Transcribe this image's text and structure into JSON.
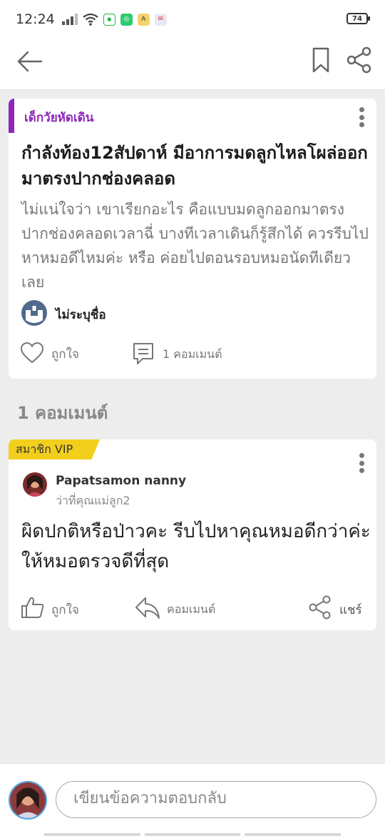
{
  "status_bar": {
    "time": "12:24",
    "battery": "74"
  },
  "post": {
    "category": "เด็กวัยหัดเดิน",
    "title": "กำลังท้อง12สัปดาห์ มีอาการมดลูกไหลโผล่ออกมาตรงปากช่องคลอด",
    "body": "ไม่แน่ใจว่า เขาเรียกอะไร คือแบบมดลูกออกมาตรงปากช่องคลอดเวลาฉี่ บางทีเวลาเดินก็รู้สึกได้ ควรรีบไปหาหมอดีไหมค่ะ หรือ ค่อยไปตอนรอบหมอนัดทีเดียวเลย",
    "author": "ไม่ระบุชื่อ",
    "like_label": "ถูกใจ",
    "comment_count_label": "1 คอมเมนต์"
  },
  "comments_section": {
    "heading": "1 คอมเมนต์"
  },
  "comment": {
    "badge": "สมาชิก VIP",
    "name": "Papatsamon nanny",
    "role": "ว่าที่คุณแม่ลูก2",
    "text": "ผิดปกติหรือป่าวคะ รีบไปหาคุณหมอดีกว่าค่ะ ให้หมอตรวจดีที่สุด",
    "like_label": "ถูกใจ",
    "reply_label": "คอมเมนต์",
    "share_label": "แชร์"
  },
  "composer": {
    "placeholder": "เขียนข้อความตอบกลับ"
  },
  "colors": {
    "category_accent": "#8d27b8",
    "vip_badge": "#f2cf1d"
  },
  "icons": [
    "back-arrow-icon",
    "bookmark-icon",
    "share-icon",
    "kebab-menu-icon",
    "heart-icon",
    "comment-bubble-icon",
    "thumbs-up-icon",
    "reply-arrow-icon"
  ]
}
